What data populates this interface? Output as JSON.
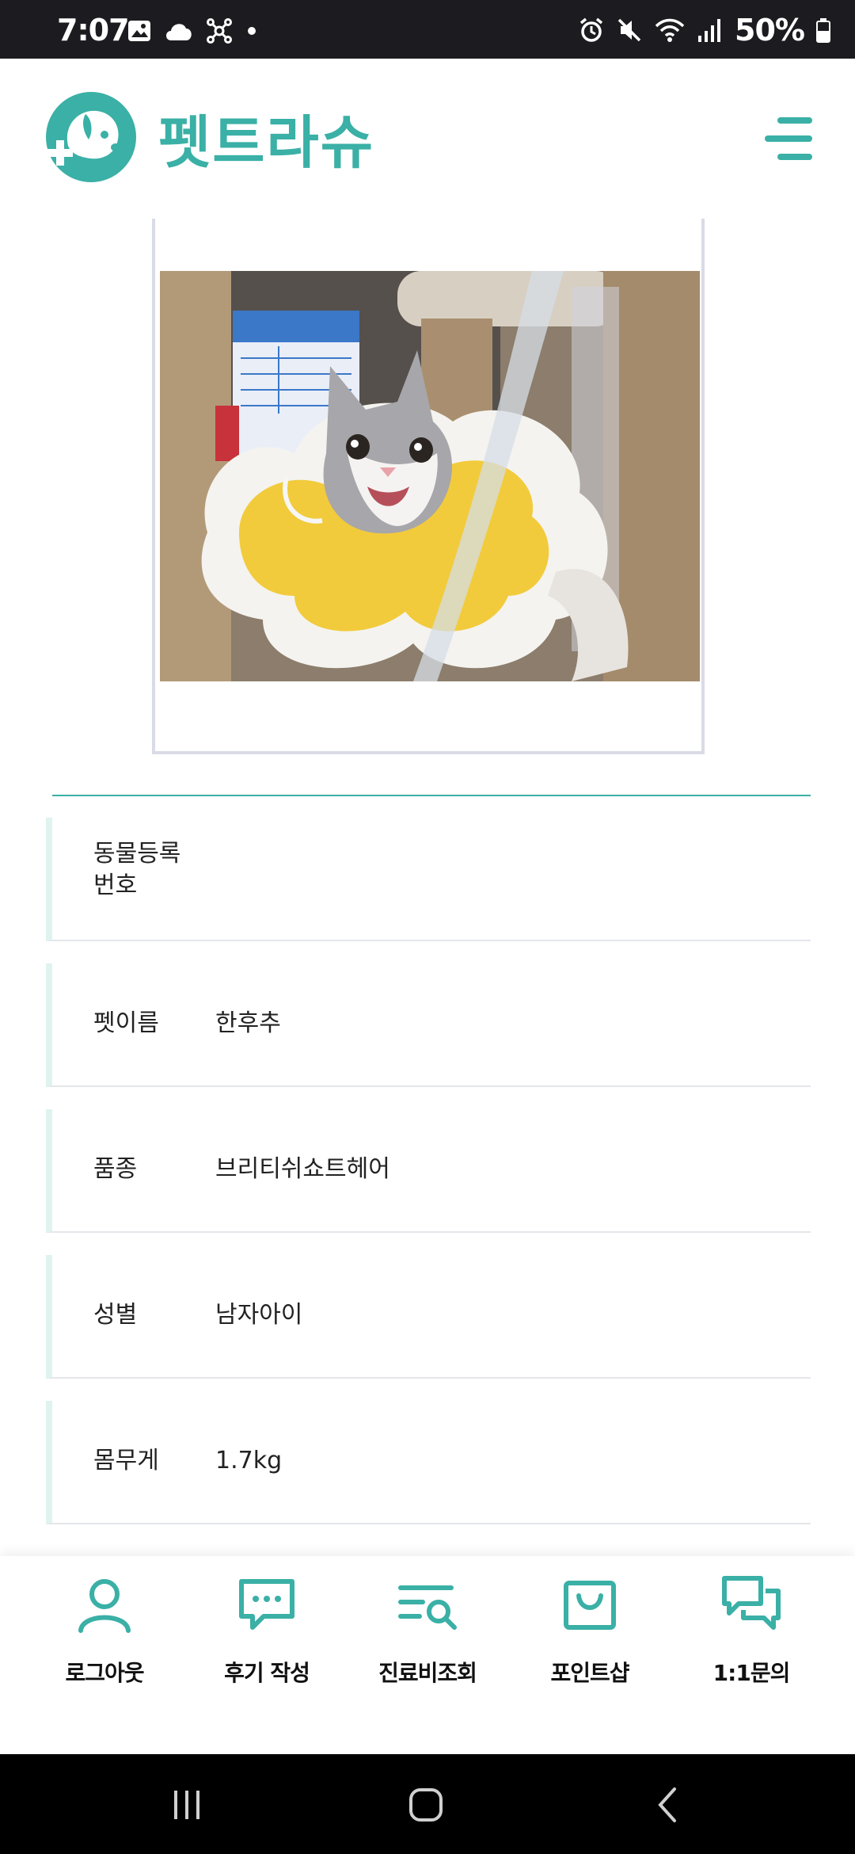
{
  "status_bar": {
    "time": "7:07",
    "battery": "50%",
    "left_icons": [
      "gallery-icon",
      "cloud-icon",
      "network-icon",
      "dot-icon"
    ],
    "right_icons": [
      "alarm-icon",
      "mute-icon",
      "wifi-icon",
      "signal-icon",
      "battery-icon"
    ]
  },
  "header": {
    "app_name": "펫트라슈",
    "accent_color": "#3ab0a6"
  },
  "pet_info": {
    "rows": [
      {
        "label": "동물등록\n번호",
        "value": ""
      },
      {
        "label": "펫이름",
        "value": "한후추"
      },
      {
        "label": "품종",
        "value": "브리티쉬쇼트헤어"
      },
      {
        "label": "성별",
        "value": "남자아이"
      },
      {
        "label": "몸무게",
        "value": "1.7kg"
      }
    ]
  },
  "bottom_nav": {
    "items": [
      {
        "label": "로그아웃",
        "icon": "user-icon"
      },
      {
        "label": "후기 작성",
        "icon": "chat-bubble-icon"
      },
      {
        "label": "진료비조회",
        "icon": "list-search-icon"
      },
      {
        "label": "포인트샵",
        "icon": "shopping-bag-icon"
      },
      {
        "label": "1:1문의",
        "icon": "messages-icon"
      }
    ]
  },
  "system_nav": [
    "recent-apps-icon",
    "home-icon",
    "back-icon"
  ]
}
